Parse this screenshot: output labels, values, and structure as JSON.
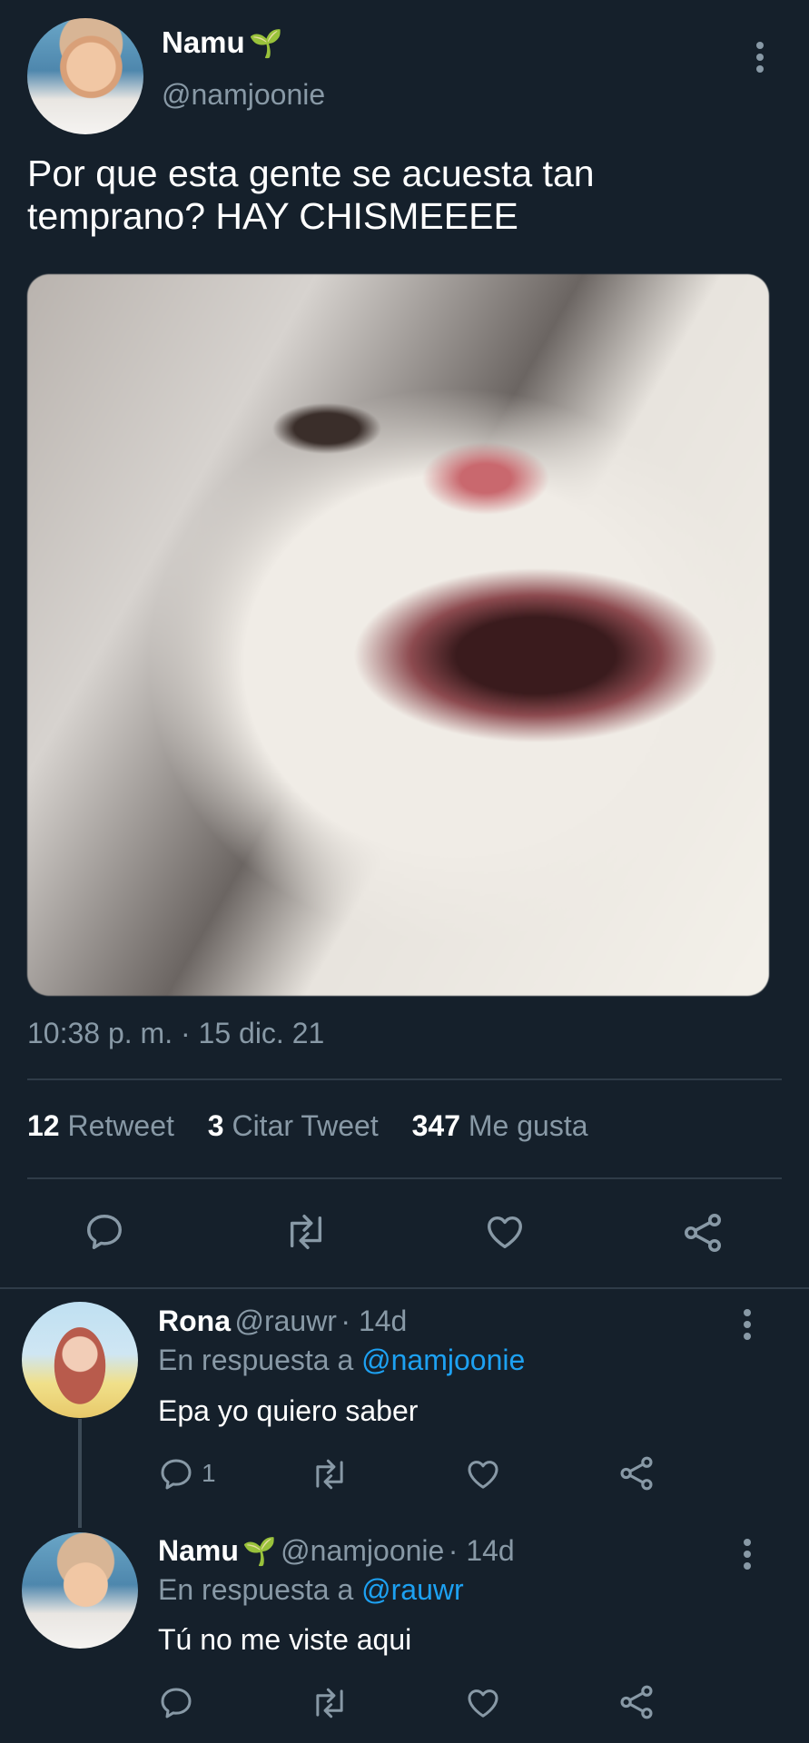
{
  "tweet": {
    "author_name": "Namu",
    "author_emoji": "🌱",
    "author_handle": "@namjoonie",
    "text": "Por que esta gente se acuesta tan temprano? HAY CHISMEEEE",
    "timestamp": "10:38 p. m. · 15 dic. 21",
    "stats": {
      "retweets_count": "12",
      "retweets_label": "Retweet",
      "quotes_count": "3",
      "quotes_label": "Citar Tweet",
      "likes_count": "347",
      "likes_label": "Me gusta"
    },
    "actions": [
      "reply-icon",
      "retweet-icon",
      "like-icon",
      "share-icon"
    ]
  },
  "replies": [
    {
      "name": "Rona",
      "handle": "@rauwr",
      "time": "· 14d",
      "in_reply_prefix": "En respuesta a",
      "in_reply_mention": "@namjoonie",
      "text": "Epa yo quiero saber",
      "reply_count": "1"
    },
    {
      "name": "Namu",
      "emoji": "🌱",
      "handle": "@namjoonie",
      "time": "· 14d",
      "in_reply_prefix": "En respuesta a",
      "in_reply_mention": "@rauwr",
      "text": "Tú no me viste aqui"
    }
  ],
  "colors": {
    "background": "#15202b",
    "secondary_text": "#8899a6",
    "link": "#1da1f2",
    "divider": "#2f3c48"
  }
}
